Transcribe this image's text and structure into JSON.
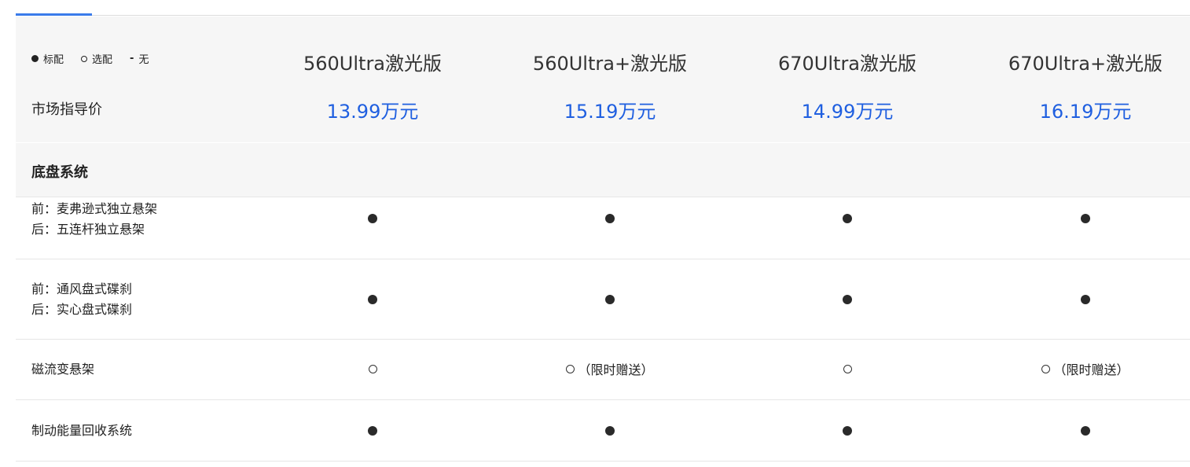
{
  "legend": {
    "standard": "标配",
    "optional": "选配",
    "none": "无"
  },
  "header": {
    "price_label": "市场指导价",
    "models": [
      {
        "name": "560Ultra激光版",
        "price": "13.99万元"
      },
      {
        "name": "560Ultra+激光版",
        "price": "15.19万元"
      },
      {
        "name": "670Ultra激光版",
        "price": "14.99万元"
      },
      {
        "name": "670Ultra+激光版",
        "price": "16.19万元"
      }
    ]
  },
  "section": {
    "title": "底盘系统"
  },
  "rows": [
    {
      "feature_line1": "前：麦弗逊式独立悬架",
      "feature_line2": "后：五连杆独立悬架",
      "cells": [
        {
          "icon": "filled-dot-icon",
          "note": ""
        },
        {
          "icon": "filled-dot-icon",
          "note": ""
        },
        {
          "icon": "filled-dot-icon",
          "note": ""
        },
        {
          "icon": "filled-dot-icon",
          "note": ""
        }
      ]
    },
    {
      "feature_line1": "前：通风盘式碟刹",
      "feature_line2": "后：实心盘式碟刹",
      "cells": [
        {
          "icon": "filled-dot-icon",
          "note": ""
        },
        {
          "icon": "filled-dot-icon",
          "note": ""
        },
        {
          "icon": "filled-dot-icon",
          "note": ""
        },
        {
          "icon": "filled-dot-icon",
          "note": ""
        }
      ]
    },
    {
      "feature_line1": "磁流变悬架",
      "feature_line2": "",
      "cells": [
        {
          "icon": "hollow-circle-icon",
          "note": ""
        },
        {
          "icon": "hollow-circle-icon",
          "note": "（限时赠送）"
        },
        {
          "icon": "hollow-circle-icon",
          "note": ""
        },
        {
          "icon": "hollow-circle-icon",
          "note": "（限时赠送）"
        }
      ]
    },
    {
      "feature_line1": "制动能量回收系统",
      "feature_line2": "",
      "cells": [
        {
          "icon": "filled-dot-icon",
          "note": ""
        },
        {
          "icon": "filled-dot-icon",
          "note": ""
        },
        {
          "icon": "filled-dot-icon",
          "note": ""
        },
        {
          "icon": "filled-dot-icon",
          "note": ""
        }
      ]
    }
  ]
}
